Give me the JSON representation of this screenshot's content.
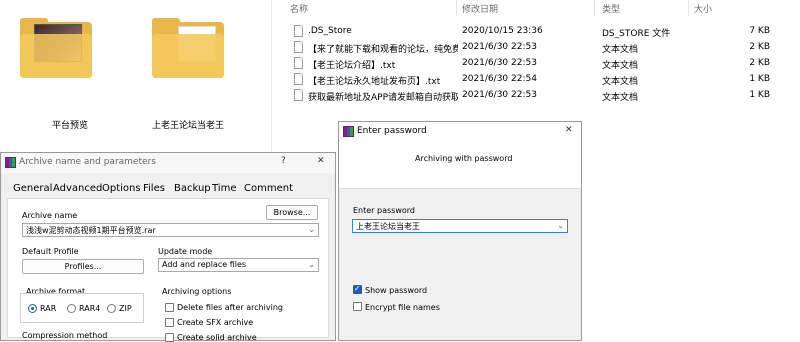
{
  "left_pane": {
    "folders": [
      {
        "label": "平台预览"
      },
      {
        "label": "上老王论坛当老王"
      }
    ]
  },
  "file_list": {
    "headers": {
      "name": "名称",
      "date": "修改日期",
      "type": "类型",
      "size": "大小"
    },
    "rows": [
      {
        "name": ".DS_Store",
        "date": "2020/10/15 23:36",
        "type": "DS_STORE 文件",
        "size": "7 KB"
      },
      {
        "name": "【来了就能下载和观看的论坛，纯免费！...",
        "date": "2021/6/30 22:53",
        "type": "文本文档",
        "size": "2 KB"
      },
      {
        "name": "【老王论坛介绍】.txt",
        "date": "2021/6/30 22:53",
        "type": "文本文档",
        "size": "2 KB"
      },
      {
        "name": "【老王论坛永久地址发布页】.txt",
        "date": "2021/6/30 22:54",
        "type": "文本文档",
        "size": "1 KB"
      },
      {
        "name": "获取最新地址及APP请发邮箱自动获取.txt",
        "date": "2021/6/30 22:53",
        "type": "文本文档",
        "size": "1 KB"
      }
    ]
  },
  "archive_dialog": {
    "title": "Archive name and parameters",
    "help": "?",
    "close": "✕",
    "tabs": [
      "General",
      "Advanced",
      "Options",
      "Files",
      "Backup",
      "Time",
      "Comment"
    ],
    "archive_name_label": "Archive name",
    "browse_label": "Browse...",
    "archive_name_value": "浅浅w泥剪动态视频1期平台预览.rar",
    "default_profile_label": "Default Profile",
    "profiles_label": "Profiles...",
    "update_mode_label": "Update mode",
    "update_mode_value": "Add and replace files",
    "archive_format_label": "Archive format",
    "formats": [
      {
        "label": "RAR",
        "selected": true
      },
      {
        "label": "RAR4",
        "selected": false
      },
      {
        "label": "ZIP",
        "selected": false
      }
    ],
    "archiving_options_label": "Archiving options",
    "options": [
      {
        "label": "Delete files after archiving",
        "checked": false
      },
      {
        "label": "Create SFX archive",
        "checked": false
      },
      {
        "label": "Create solid archive",
        "checked": false
      }
    ],
    "compression_method_label": "Compression method"
  },
  "password_dialog": {
    "title": "Enter password",
    "close": "✕",
    "heading": "Archiving with password",
    "enter_password_label": "Enter password",
    "password_value": "上老王论坛当老王",
    "show_password_label": "Show password",
    "show_password_checked": true,
    "encrypt_names_label": "Encrypt file names",
    "encrypt_names_checked": false
  }
}
